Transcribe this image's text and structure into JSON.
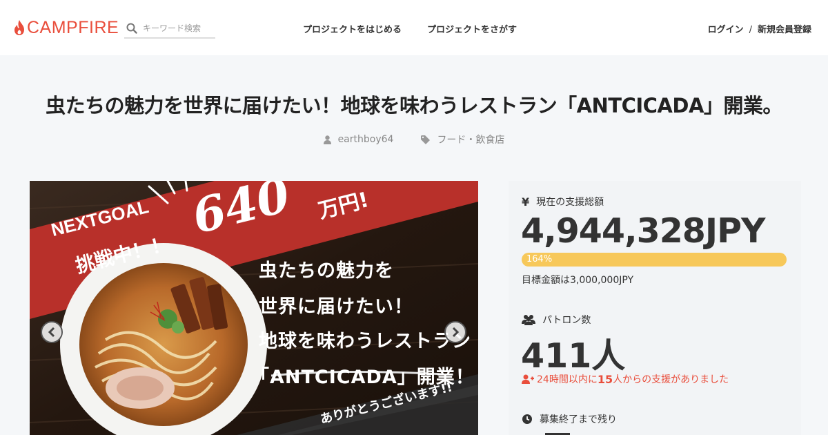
{
  "header": {
    "logo_text": "CAMPFIRE",
    "search_placeholder": "キーワード検索",
    "nav": {
      "start": "プロジェクトをはじめる",
      "find": "プロジェクトをさがす"
    },
    "login": "ログイン",
    "separator": "/",
    "signup": "新規会員登録"
  },
  "project": {
    "title": "虫たちの魅力を世界に届けたい！地球を味わうレストラン「ANTCICADA」開業。",
    "owner": "earthboy64",
    "category": "フード・飲食店"
  },
  "hero": {
    "goal_label": "NEXTGOAL",
    "goal_challenge": "挑戦中！！",
    "goal_amount": "640",
    "goal_unit": "万円!",
    "copy": [
      "虫たちの魅力を",
      "世界に届けたい！",
      "地球を味わうレストラン",
      "「ANTCICADA」開業！"
    ],
    "thanks": "ありがとうございます!!"
  },
  "stats": {
    "funded_label": "現在の支援総額",
    "funded_amount": "4,944,328JPY",
    "progress_label": "164%",
    "progress_value": 1.64,
    "goal_text": "目標金額は3,000,000JPY",
    "patrons_label": "パトロン数",
    "patrons_count": "411人",
    "recent_prefix": "24時間以内に",
    "recent_count": "15",
    "recent_suffix": "人からの支援がありました",
    "remaining_label": "募集終了まで残り"
  },
  "colors": {
    "brand": "#e94e3c",
    "progress": "#f7c85a",
    "hero_red": "#b8302a"
  }
}
